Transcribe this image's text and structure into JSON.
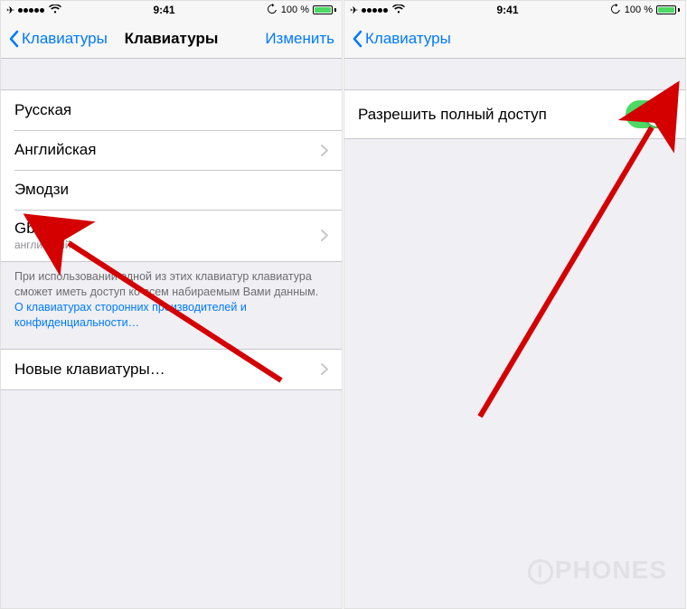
{
  "status": {
    "time": "9:41",
    "battery_pct": "100 %"
  },
  "screen1": {
    "nav": {
      "back": "Клавиатуры",
      "title": "Клавиатуры",
      "edit": "Изменить"
    },
    "rows": {
      "r0": {
        "label": "Русская"
      },
      "r1": {
        "label": "Английская"
      },
      "r2": {
        "label": "Эмодзи"
      },
      "r3": {
        "label": "Gboard",
        "sub": "английский"
      }
    },
    "footer": {
      "text": "При использовании одной из этих клавиатур клавиатура сможет иметь доступ ко всем набираемым Вами данным. ",
      "link": "О клавиатурах сторонних производителей и конфиденциальности…"
    },
    "rows2": {
      "r0": {
        "label": "Новые клавиатуры…"
      }
    }
  },
  "screen2": {
    "nav": {
      "back": "Клавиатуры"
    },
    "rows": {
      "r0": {
        "label": "Разрешить полный доступ",
        "on": true
      }
    }
  },
  "watermark": "PHONES"
}
